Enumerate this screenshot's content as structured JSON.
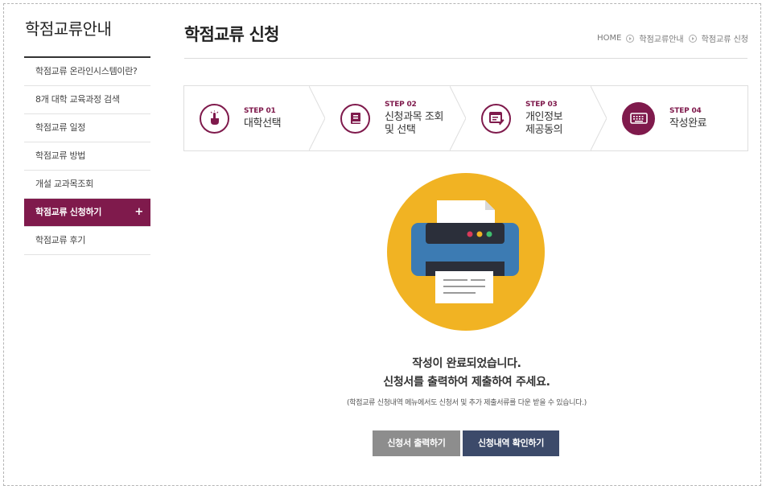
{
  "sidebar": {
    "title": "학점교류안내",
    "items": [
      {
        "label": "학점교류 온라인시스템이란?"
      },
      {
        "label": "8개 대학 교육과정 검색"
      },
      {
        "label": "학점교류 일정"
      },
      {
        "label": "학점교류 방법"
      },
      {
        "label": "개설 교과목조회"
      },
      {
        "label": "학점교류 신청하기",
        "active": true,
        "expand": "+"
      },
      {
        "label": "학점교류 후기"
      }
    ]
  },
  "header": {
    "title": "학점교류 신청",
    "breadcrumb": [
      "HOME",
      "학점교류안내",
      "학점교류 신청"
    ]
  },
  "steps": [
    {
      "num": "STEP 01",
      "label": "대학선택",
      "icon": "hand-pointer-icon"
    },
    {
      "num": "STEP 02",
      "label": "신청과목 조회\n및 선택",
      "icon": "book-icon"
    },
    {
      "num": "STEP 03",
      "label": "개인정보\n제공동의",
      "icon": "form-edit-icon"
    },
    {
      "num": "STEP 04",
      "label": "작성완료",
      "icon": "keyboard-icon",
      "current": true
    }
  ],
  "message": {
    "line1": "작성이 완료되었습니다.",
    "line2": "신청서를 출력하여 제출하여 주세요.",
    "note": "(학점교류 신청내역 메뉴에서도 신청서 및 추가 제출서류를 다운 받을 수 있습니다.)"
  },
  "buttons": {
    "print": "신청서 출력하기",
    "check": "신청내역 확인하기"
  },
  "colors": {
    "accent": "#7f1a4c",
    "check_button": "#3c4a6a",
    "print_button": "#8d8d8d",
    "illustration_bg": "#f1b323",
    "printer_body": "#3c7bb3"
  }
}
